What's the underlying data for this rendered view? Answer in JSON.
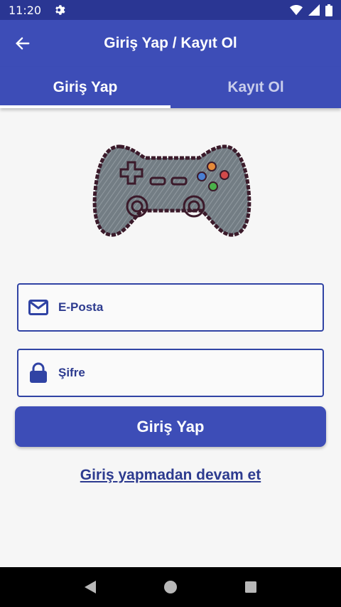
{
  "status_bar": {
    "time": "11:20"
  },
  "app_bar": {
    "title": "Giriş Yap / Kayıt Ol"
  },
  "tabs": [
    {
      "label": "Giriş Yap",
      "active": true
    },
    {
      "label": "Kayıt Ol",
      "active": false
    }
  ],
  "form": {
    "email_label": "E-Posta",
    "password_label": "Şifre",
    "login_button": "Giriş Yap",
    "guest_link": "Giriş yapmadan devam et"
  },
  "colors": {
    "primary": "#3d4db7",
    "primary_dark": "#2a3693",
    "accent_text": "#2d3b8f"
  },
  "icons": {
    "status": [
      "gear-icon",
      "wifi-icon",
      "signal-icon",
      "battery-icon"
    ],
    "app_bar": "back-arrow-icon",
    "email": "mail-icon",
    "password": "lock-icon",
    "logo": "gamepad-icon",
    "nav": [
      "back-triangle-icon",
      "home-circle-icon",
      "recents-square-icon"
    ]
  }
}
